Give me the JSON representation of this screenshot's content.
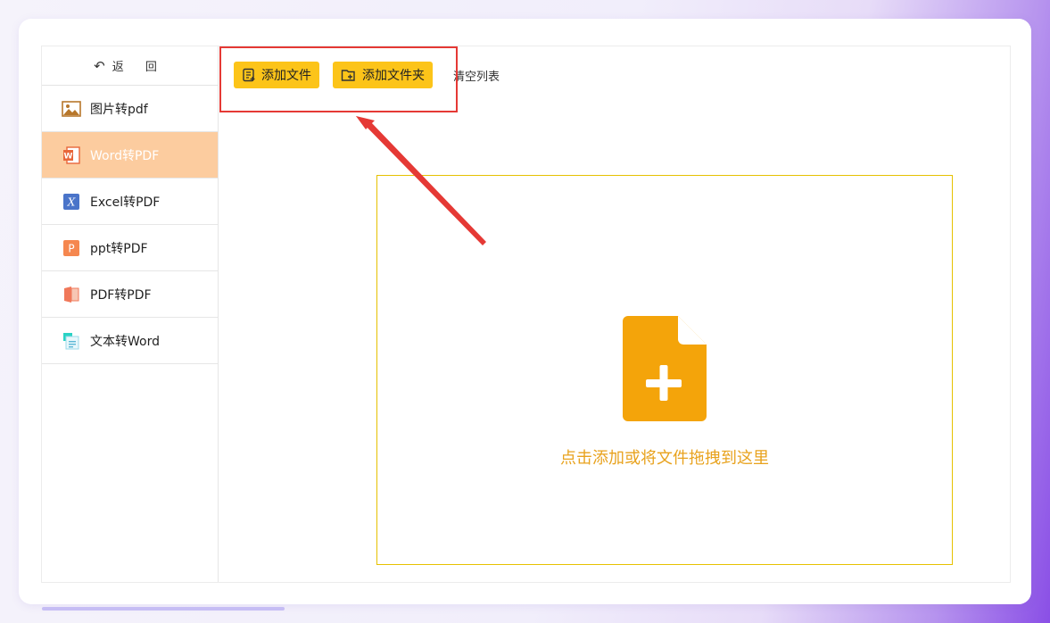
{
  "sidebar": {
    "back_label": "返 回",
    "items": [
      {
        "label": "图片转pdf",
        "icon": "image-icon",
        "active": false
      },
      {
        "label": "Word转PDF",
        "icon": "word-icon",
        "active": true
      },
      {
        "label": "Excel转PDF",
        "icon": "excel-icon",
        "active": false
      },
      {
        "label": "ppt转PDF",
        "icon": "ppt-icon",
        "active": false
      },
      {
        "label": "PDF转PDF",
        "icon": "pdf-icon",
        "active": false
      },
      {
        "label": "文本转Word",
        "icon": "text-icon",
        "active": false
      }
    ]
  },
  "toolbar": {
    "add_file_label": "添加文件",
    "add_folder_label": "添加文件夹",
    "clear_label": "清空列表"
  },
  "dropzone": {
    "hint": "点击添加或将文件拖拽到这里",
    "icon": "add-file-icon"
  },
  "colors": {
    "accent": "#fcc419",
    "active_bg": "#fccc9f",
    "drop_icon": "#f4a40a",
    "drop_text": "#e8a21d",
    "annotation": "#e53935"
  }
}
